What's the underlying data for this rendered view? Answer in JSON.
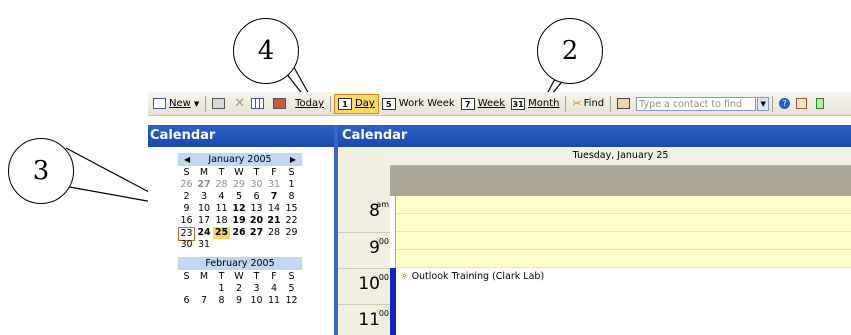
{
  "callouts": [
    "4",
    "2",
    "3"
  ],
  "toolbar": {
    "new_label": "New",
    "today_label": "Today",
    "day_label": "Day",
    "day_icon": "1",
    "workweek_label": "Work Week",
    "workweek_icon": "5",
    "week_label": "Week",
    "week_icon": "7",
    "month_label": "Month",
    "month_icon": "31",
    "find_label": "Find",
    "contact_placeholder": "Type a contact to find"
  },
  "nav": {
    "title": "Calendar",
    "jan": {
      "title": "January 2005",
      "dow": [
        "S",
        "M",
        "T",
        "W",
        "T",
        "F",
        "S"
      ],
      "weeks": [
        [
          "26",
          "27",
          "28",
          "29",
          "30",
          "31",
          "1"
        ],
        [
          "2",
          "3",
          "4",
          "5",
          "6",
          "7",
          "8"
        ],
        [
          "9",
          "10",
          "11",
          "12",
          "13",
          "14",
          "15"
        ],
        [
          "16",
          "17",
          "18",
          "19",
          "20",
          "21",
          "22"
        ],
        [
          "23",
          "24",
          "25",
          "26",
          "27",
          "28",
          "29"
        ],
        [
          "30",
          "31",
          "",
          "",
          "",
          "",
          ""
        ]
      ]
    },
    "feb": {
      "title": "February 2005",
      "dow": [
        "S",
        "M",
        "T",
        "W",
        "T",
        "F",
        "S"
      ],
      "weeks": [
        [
          "",
          "",
          "1",
          "2",
          "3",
          "4",
          "5"
        ],
        [
          "6",
          "7",
          "8",
          "9",
          "10",
          "11",
          "12"
        ]
      ]
    }
  },
  "main": {
    "title": "Calendar",
    "day_heading": "Tuesday, January 25",
    "hours": [
      {
        "h": "8",
        "m": "am"
      },
      {
        "h": "9",
        "m": "00"
      },
      {
        "h": "10",
        "m": "00"
      },
      {
        "h": "11",
        "m": "00"
      }
    ],
    "appointment": "Outlook Training (Clark Lab)"
  },
  "colors": {
    "header_blue": "#1b49a8",
    "selected_day": "#fbd86a",
    "busy_bar": "#1521c0",
    "free_slot": "#ffffc8"
  }
}
